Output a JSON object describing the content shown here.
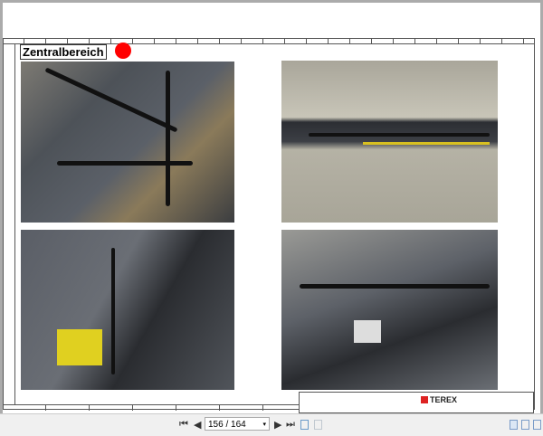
{
  "document": {
    "section_title": "Zentralbereich",
    "title_block": {
      "brand": "TEREX"
    }
  },
  "toolbar": {
    "first_page": "⏮",
    "prev_page": "◀",
    "page_indicator": "156 / 164",
    "dropdown": "▾",
    "next_page": "▶",
    "last_page": "⏭"
  }
}
